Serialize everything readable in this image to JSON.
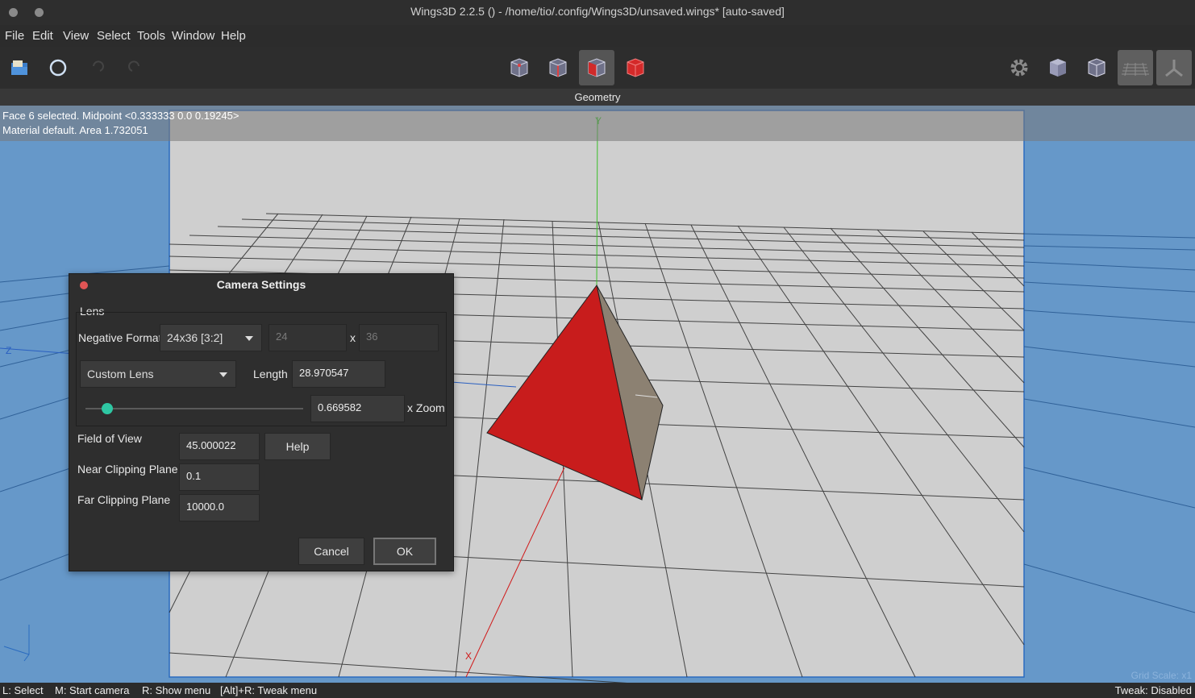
{
  "window": {
    "title": "Wings3D 2.2.5 () - /home/tio/.config/Wings3D/unsaved.wings* [auto-saved]"
  },
  "menu": [
    "File",
    "Edit",
    "View",
    "Select",
    "Tools",
    "Window",
    "Help"
  ],
  "toolbar": {
    "left_icons": [
      "open-file-icon",
      "save-icon",
      "undo-icon",
      "redo-icon"
    ],
    "mode_icons": [
      "vertex-mode-icon",
      "edge-mode-icon",
      "face-mode-icon",
      "body-mode-icon"
    ],
    "right_icons": [
      "settings-gear-icon",
      "smooth-shading-icon",
      "wireframe-shading-icon",
      "ground-plane-icon",
      "axes-icon"
    ]
  },
  "geometry_label": "Geometry",
  "info": {
    "line1": "Face 6 selected. Midpoint <0.333333  0.0  0.19245>",
    "line2": "Material default. Area 1.732051"
  },
  "axes": {
    "y": "Y",
    "z": "Z",
    "x": "X"
  },
  "grid_scale": "Grid Scale: x1",
  "status": {
    "select": "L: Select",
    "camera": "M: Start camera",
    "menu": "R: Show menu",
    "tweak_menu": "[Alt]+R: Tweak menu",
    "tweak": "Tweak: Disabled"
  },
  "dialog": {
    "title": "Camera Settings",
    "lens_group": "Lens",
    "negative_format_label": "Negative Format",
    "negative_format_value": "24x36 [3:2]",
    "width": "24",
    "x_sep": "x",
    "height": "36",
    "lens_type": "Custom Lens",
    "length_label": "Length",
    "length_value": "28.970547",
    "zoom_value": "0.669582",
    "zoom_label": "x Zoom",
    "zoom_slider": 0.1,
    "fov_label": "Field of View",
    "fov_value": "45.000022",
    "help": "Help",
    "near_label": "Near Clipping Plane",
    "near_value": "0.1",
    "far_label": "Far Clipping Plane",
    "far_value": "10000.0",
    "cancel": "Cancel",
    "ok": "OK"
  },
  "colors": {
    "viewport_bg": "#6698c9",
    "camera_frame_bg": "#cfcfcf",
    "face_selected": "#c41e1e",
    "slider_accent": "#2ec7a3"
  }
}
